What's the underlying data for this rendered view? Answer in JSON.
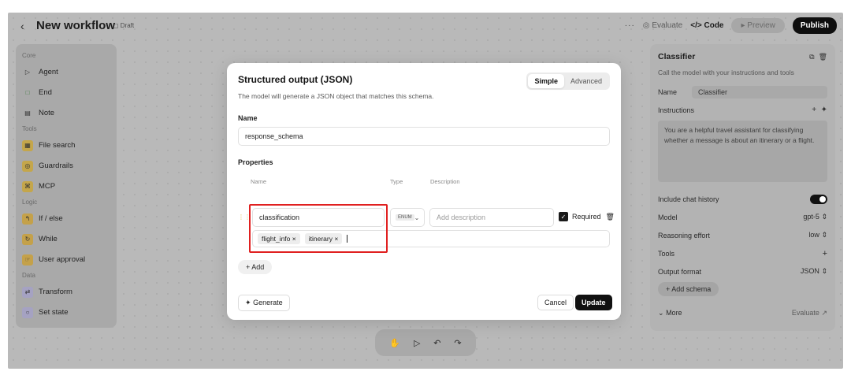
{
  "topbar": {
    "title": "New workflow",
    "draft": "Draft",
    "dots": "···",
    "evaluate": "Evaluate",
    "code": "Code",
    "preview": "Preview",
    "publish": "Publish"
  },
  "sidebar": {
    "sections": [
      {
        "label": "Core",
        "items": [
          {
            "label": "Agent",
            "icon": "play-icon",
            "color": "#9aa4c0"
          },
          {
            "label": "End",
            "icon": "square-icon",
            "color": "#8fb08f"
          },
          {
            "label": "Note",
            "icon": "note-icon",
            "color": "#9a9a9a"
          }
        ]
      },
      {
        "label": "Tools",
        "items": [
          {
            "label": "File search",
            "icon": "file-search-icon",
            "color": "#c4a64b"
          },
          {
            "label": "Guardrails",
            "icon": "shield-icon",
            "color": "#c4a64b"
          },
          {
            "label": "MCP",
            "icon": "mcp-icon",
            "color": "#c4a64b"
          }
        ]
      },
      {
        "label": "Logic",
        "items": [
          {
            "label": "If / else",
            "icon": "branch-icon",
            "color": "#c4a14a"
          },
          {
            "label": "While",
            "icon": "loop-icon",
            "color": "#c4a14a"
          },
          {
            "label": "User approval",
            "icon": "approval-icon",
            "color": "#c4a14a"
          }
        ]
      },
      {
        "label": "Data",
        "items": [
          {
            "label": "Transform",
            "icon": "transform-icon",
            "color": "#a5a2c2"
          },
          {
            "label": "Set state",
            "icon": "set-state-icon",
            "color": "#a5a2c2"
          }
        ]
      }
    ]
  },
  "inspector": {
    "title": "Classifier",
    "subtitle": "Call the model with your instructions and tools",
    "name_label": "Name",
    "name_value": "Classifier",
    "instructions_label": "Instructions",
    "instructions_text": "You are a helpful travel assistant for classifying whether a message is about an itinerary or a flight.",
    "chat_history_label": "Include chat history",
    "chat_history_on": true,
    "model_label": "Model",
    "model_value": "gpt-5",
    "reasoning_label": "Reasoning effort",
    "reasoning_value": "low",
    "tools_label": "Tools",
    "output_label": "Output format",
    "output_value": "JSON",
    "add_schema": "Add schema",
    "more": "More",
    "evaluate": "Evaluate"
  },
  "modal": {
    "title": "Structured output (JSON)",
    "description": "The model will generate a JSON object that matches this schema.",
    "mode_simple": "Simple",
    "mode_advanced": "Advanced",
    "name_label": "Name",
    "name_value": "response_schema",
    "properties_label": "Properties",
    "col_name": "Name",
    "col_type": "Type",
    "col_description": "Description",
    "property": {
      "name": "classification",
      "type": "ENUM",
      "description_placeholder": "Add description",
      "required_label": "Required",
      "enum_values": [
        "flight_info",
        "itinerary"
      ]
    },
    "add_label": "Add",
    "generate_label": "Generate",
    "cancel_label": "Cancel",
    "update_label": "Update"
  }
}
